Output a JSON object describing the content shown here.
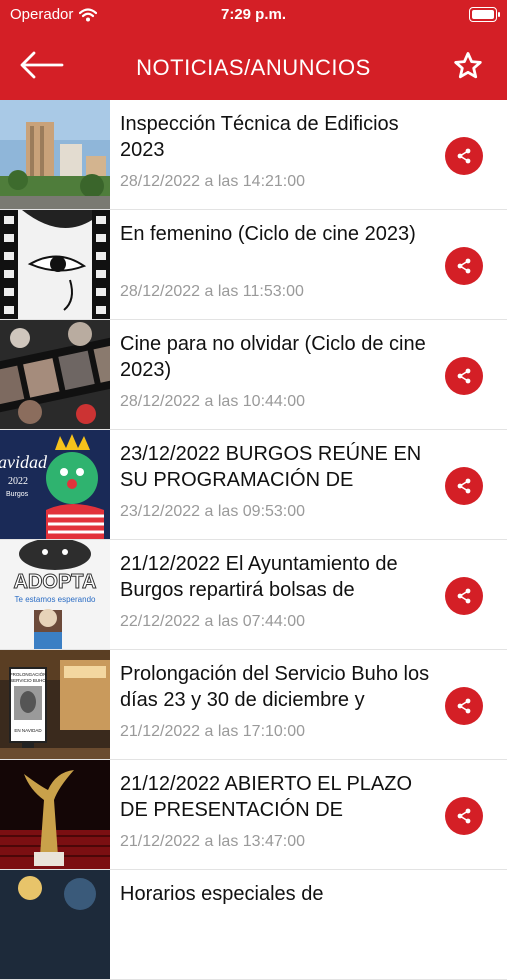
{
  "status_bar": {
    "carrier": "Operador",
    "time": "7:29 p.m."
  },
  "header": {
    "title": "NOTICIAS/ANUNCIOS",
    "back_icon": "arrow-left-icon",
    "favorite_icon": "star-outline-icon"
  },
  "thumb_texts": {
    "navidad": "avidad",
    "navidad_year": "2022",
    "navidad_city": "Burgos",
    "adopta": "ADOPTA",
    "adopta_sub": "Te estamos esperando",
    "buho_1": "PROLONGACIÓN",
    "buho_2": "SERVICIO BUHO",
    "buho_3": "EN NAVIDAD"
  },
  "news": [
    {
      "title": "Inspección Técnica de Edificios 2023",
      "date": "28/12/2022 a las 14:21:00"
    },
    {
      "title": "En femenino (Ciclo de cine 2023)",
      "date": "28/12/2022 a las 11:53:00"
    },
    {
      "title": "Cine para no olvidar (Ciclo de cine 2023)",
      "date": "28/12/2022 a las 10:44:00"
    },
    {
      "title": "23/12/2022 BURGOS REÚNE EN SU PROGRAMACIÓN DE",
      "date": "23/12/2022 a las 09:53:00"
    },
    {
      "title": "21/12/2022 El Ayuntamiento de Burgos repartirá bolsas de",
      "date": "22/12/2022 a las 07:44:00"
    },
    {
      "title": "Prolongación del Servicio Buho los días 23 y 30 de diciembre y",
      "date": "21/12/2022 a las 17:10:00"
    },
    {
      "title": "21/12/2022 ABIERTO EL PLAZO DE PRESENTACIÓN DE",
      "date": "21/12/2022 a las 13:47:00"
    },
    {
      "title": "Horarios especiales de",
      "date": ""
    }
  ],
  "colors": {
    "primary": "#d41f26",
    "date_text": "#9a9a9a"
  }
}
